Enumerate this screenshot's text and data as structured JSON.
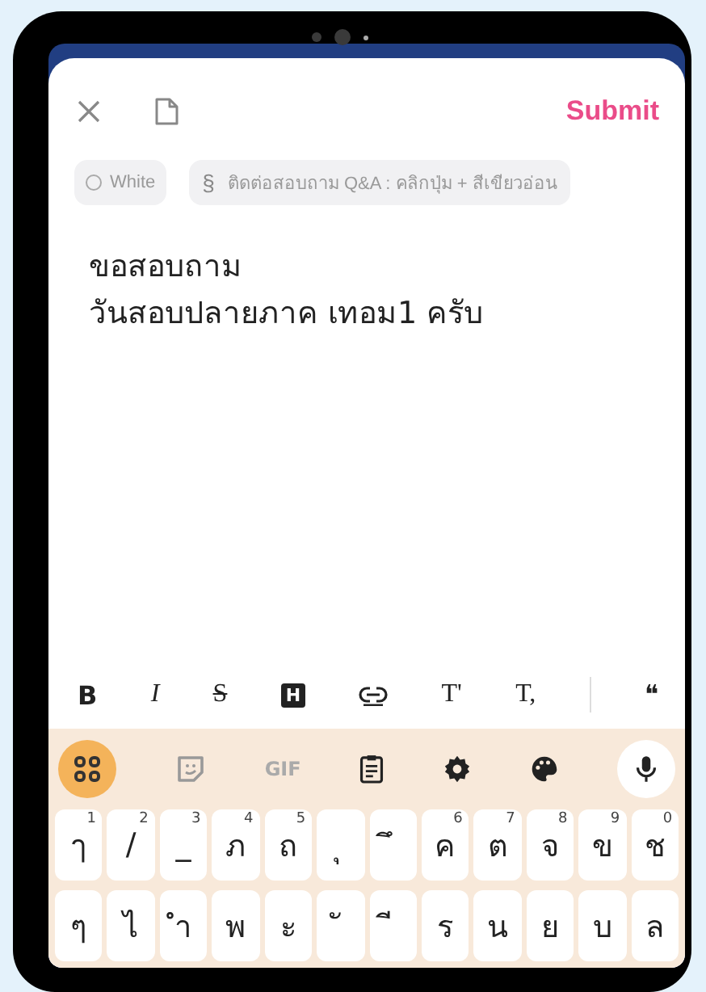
{
  "header": {
    "submit": "Submit"
  },
  "chips": [
    {
      "kind": "color",
      "label": "White",
      "selected": false
    },
    {
      "kind": "section",
      "icon_text": "§",
      "label": "ติดต่อสอบถาม Q&A : คลิกปุ่ม + สีเขียวอ่อน"
    }
  ],
  "body_lines": [
    "ขอสอบถาม",
    "วันสอบปลายภาค เทอม1 ครับ"
  ],
  "format_tools": [
    {
      "kind": "bold",
      "label": "B"
    },
    {
      "kind": "italic",
      "label": "I"
    },
    {
      "kind": "strike",
      "label": "S"
    },
    {
      "kind": "heading",
      "label": "H"
    },
    {
      "kind": "link"
    },
    {
      "kind": "text",
      "label": "T'"
    },
    {
      "kind": "text",
      "label": "T,"
    },
    {
      "kind": "divider"
    },
    {
      "kind": "text",
      "label": "❝"
    }
  ],
  "keyboard_tools": [
    {
      "kind": "apps",
      "selected": true
    },
    {
      "kind": "sticker"
    },
    {
      "kind": "gif",
      "label": "GIF"
    },
    {
      "kind": "clipboard"
    },
    {
      "kind": "settings"
    },
    {
      "kind": "palette"
    },
    {
      "kind": "mic"
    }
  ],
  "key_rows": [
    [
      {
        "char": "ๅ",
        "hint": "1"
      },
      {
        "char": "/",
        "hint": "2"
      },
      {
        "char": "_",
        "hint": "3"
      },
      {
        "char": "ภ",
        "hint": "4"
      },
      {
        "char": "ถ",
        "hint": "5"
      },
      {
        "char": "ุ"
      },
      {
        "char": "ึ"
      },
      {
        "char": "ค",
        "hint": "6"
      },
      {
        "char": "ต",
        "hint": "7"
      },
      {
        "char": "จ",
        "hint": "8"
      },
      {
        "char": "ข",
        "hint": "9"
      },
      {
        "char": "ช",
        "hint": "0"
      }
    ],
    [
      {
        "char": "ๆ"
      },
      {
        "char": "ไ"
      },
      {
        "char": "ำ"
      },
      {
        "char": "พ"
      },
      {
        "char": "ะ"
      },
      {
        "char": "ั"
      },
      {
        "char": "ี"
      },
      {
        "char": "ร"
      },
      {
        "char": "น"
      },
      {
        "char": "ย"
      },
      {
        "char": "บ"
      },
      {
        "char": "ล"
      }
    ]
  ]
}
